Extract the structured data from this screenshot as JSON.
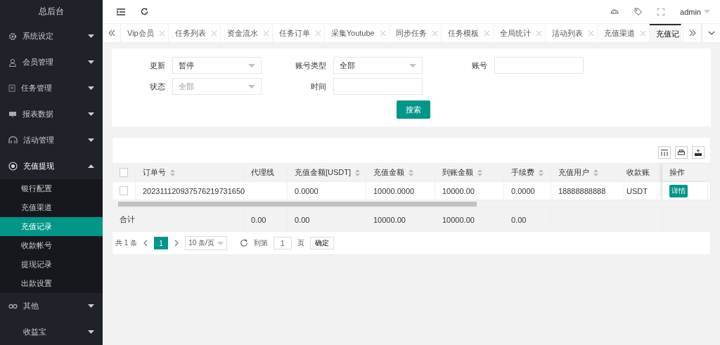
{
  "sidebar": {
    "title": "总后台",
    "items": [
      {
        "label": "系统设定",
        "expanded": false
      },
      {
        "label": "会员管理",
        "expanded": false
      },
      {
        "label": "任务管理",
        "expanded": false
      },
      {
        "label": "报表数据",
        "expanded": false
      },
      {
        "label": "活动管理",
        "expanded": false
      },
      {
        "label": "充值提现",
        "expanded": true,
        "children": [
          {
            "label": "银行配置",
            "selected": false
          },
          {
            "label": "充值渠道",
            "selected": false
          },
          {
            "label": "充值记录",
            "selected": true
          },
          {
            "label": "收款帐号",
            "selected": false
          },
          {
            "label": "提现记录",
            "selected": false
          },
          {
            "label": "出款设置",
            "selected": false
          }
        ]
      },
      {
        "label": "其他",
        "expanded": false
      },
      {
        "label": "收益宝",
        "expanded": false
      }
    ]
  },
  "topbar": {
    "user": "admin"
  },
  "tabs": [
    {
      "label": "Vip会员",
      "selected": false
    },
    {
      "label": "任务列表",
      "selected": false
    },
    {
      "label": "资金流水",
      "selected": false
    },
    {
      "label": "任务订单",
      "selected": false
    },
    {
      "label": "采集Youtube",
      "selected": false
    },
    {
      "label": "同步任务",
      "selected": false
    },
    {
      "label": "任务模板",
      "selected": false
    },
    {
      "label": "全局统计",
      "selected": false
    },
    {
      "label": "活动列表",
      "selected": false
    },
    {
      "label": "充值渠道",
      "selected": false
    },
    {
      "label": "充值记",
      "selected": true
    }
  ],
  "filters": [
    {
      "label": "更新",
      "kind": "select",
      "value": "暂停"
    },
    {
      "label": "账号类型",
      "kind": "select",
      "value": "全部"
    },
    {
      "label": "账号",
      "kind": "input"
    },
    {
      "label": "状态",
      "kind": "select",
      "placeholder": "全部"
    },
    {
      "label": "时间",
      "kind": "input"
    }
  ],
  "search_button": "搜索",
  "table": {
    "all_checked": false,
    "columns": [
      {
        "label": "订单号",
        "sortable": true
      },
      {
        "label": "代理线",
        "sortable": false
      },
      {
        "label": "充值金额[USDT]",
        "sortable": true
      },
      {
        "label": "充值金额",
        "sortable": true
      },
      {
        "label": "到账金额",
        "sortable": true
      },
      {
        "label": "手续费",
        "sortable": true
      },
      {
        "label": "充值用户",
        "sortable": true
      },
      {
        "label": "收款账",
        "sortable": false
      },
      {
        "label": "操作",
        "sortable": false
      }
    ],
    "rows": [
      {
        "checked": false,
        "cells": [
          "202311120937576219731650",
          "",
          "0.0000",
          "10000.0000",
          "10000.00",
          "0.0000",
          "18888888888",
          "USDT"
        ],
        "action": "详情"
      }
    ],
    "totals": {
      "label": "合计",
      "cells": [
        "0.00",
        "0.00",
        "10000.00",
        "10000.00",
        "0.00"
      ]
    }
  },
  "pagination": {
    "total": "共 1 条",
    "pages": [
      {
        "label": "1",
        "selected": true
      }
    ],
    "page_size": "10 条/页",
    "goto_label": "到第",
    "goto_value": "1",
    "page_unit": "页",
    "confirm": "确定"
  }
}
